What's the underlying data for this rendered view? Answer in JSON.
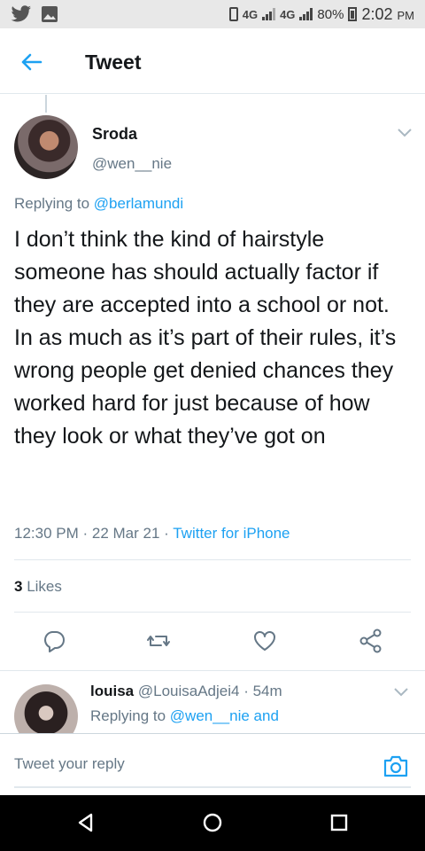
{
  "status_bar": {
    "network1": "4G",
    "network2": "4G",
    "battery": "80%",
    "time": "2:02",
    "ampm": "PM"
  },
  "header": {
    "title": "Tweet"
  },
  "tweet": {
    "name": "Sroda",
    "handle": "@wen__nie",
    "replying_prefix": "Replying to ",
    "replying_to": "@berlamundi",
    "text": "I don’t think the kind of hairstyle someone has should actually factor if they are accepted into a school or not. In as much as it’s part of their rules, it’s wrong people get denied chances they worked hard for just because of how they look or what they’ve got on",
    "time": "12:30 PM",
    "date": "22 Mar 21",
    "source": "Twitter for iPhone",
    "likes_count": "3",
    "likes_label": "Likes"
  },
  "reply": {
    "name": "louisa",
    "handle": "@LouisaAdjei4",
    "age": "54m",
    "replying_prefix": "Replying to ",
    "replying_to": "@wen__nie and"
  },
  "composer": {
    "placeholder": "Tweet your reply"
  },
  "colors": {
    "accent": "#1da1f2",
    "secondary_text": "#657786",
    "divider": "#e1e8ed"
  },
  "icons": [
    "twitter-icon",
    "gallery-icon",
    "vibrate-icon",
    "signal-icon",
    "battery-icon",
    "back-arrow-icon",
    "chevron-down-icon",
    "reply-icon",
    "retweet-icon",
    "like-icon",
    "share-icon",
    "camera-icon",
    "nav-back-icon",
    "nav-home-icon",
    "nav-recents-icon"
  ]
}
